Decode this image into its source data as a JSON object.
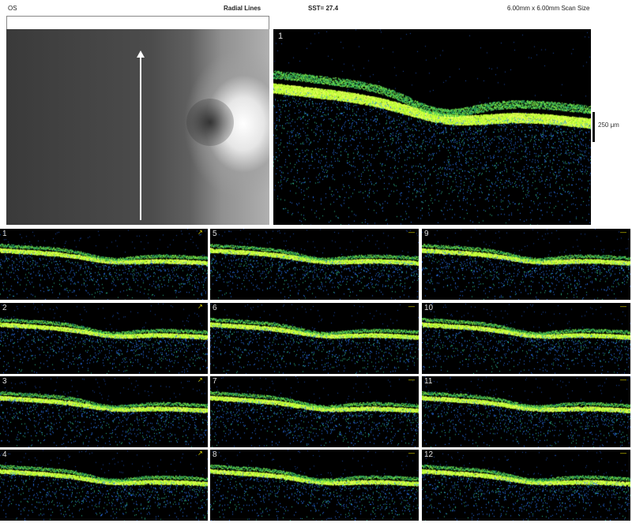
{
  "header": {
    "eye": "OS",
    "scan_pattern": "Radial Lines",
    "signal_strength": "SST= 27.4",
    "scan_size": "6.00mm x 6.00mm Scan Size"
  },
  "main_scan": {
    "number": "1",
    "scale_label": "250 μm"
  },
  "thumbnails": [
    {
      "number": "1"
    },
    {
      "number": "5"
    },
    {
      "number": "9"
    },
    {
      "number": "2"
    },
    {
      "number": "6"
    },
    {
      "number": "10"
    },
    {
      "number": "3"
    },
    {
      "number": "7"
    },
    {
      "number": "11"
    },
    {
      "number": "4"
    },
    {
      "number": "8"
    },
    {
      "number": "12"
    }
  ],
  "colors": {
    "retina_layer": "#b8ff30",
    "speckle": "#2e7cff",
    "background": "#000000"
  }
}
